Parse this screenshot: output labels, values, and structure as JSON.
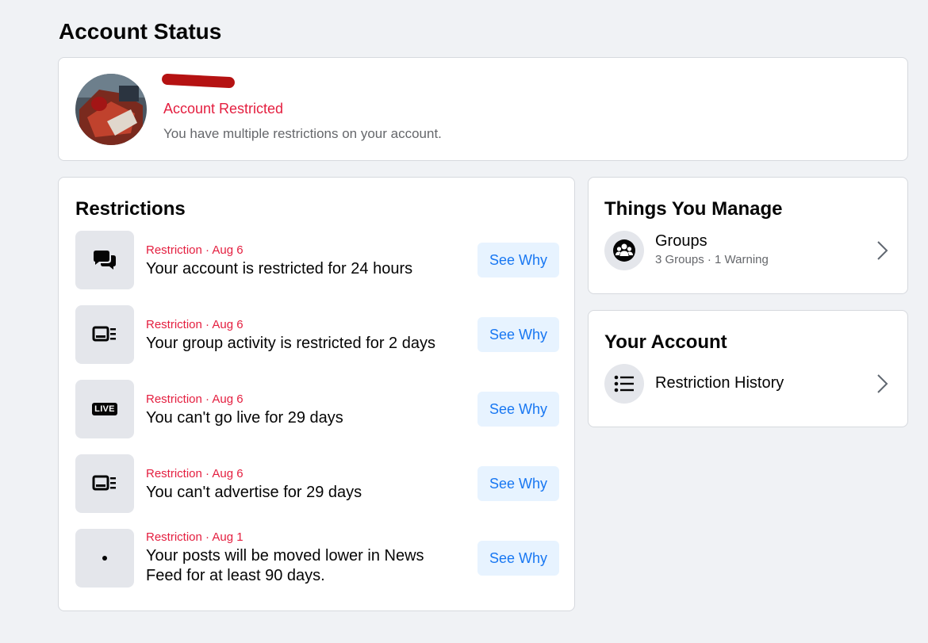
{
  "page": {
    "title": "Account Status"
  },
  "profile": {
    "status": "Account Restricted",
    "subtitle": "You have multiple restrictions on your account."
  },
  "restrictions": {
    "title": "Restrictions",
    "items": [
      {
        "meta": "Restriction · Aug 6",
        "title": "Your account is restricted for 24 hours",
        "icon": "chat-bubbles-icon",
        "button": "See Why"
      },
      {
        "meta": "Restriction · Aug 6",
        "title": "Your group activity is restricted for 2 days",
        "icon": "ad-layout-icon",
        "button": "See Why"
      },
      {
        "meta": "Restriction · Aug 6",
        "title": "You can't go live for 29 days",
        "icon": "live-icon",
        "icon_text": "LIVE",
        "button": "See Why"
      },
      {
        "meta": "Restriction · Aug 6",
        "title": "You can't advertise for 29 days",
        "icon": "ad-layout-icon",
        "button": "See Why"
      },
      {
        "meta": "Restriction · Aug 1",
        "title": "Your posts will be moved lower in News Feed for at least 90 days.",
        "icon": "dot-icon",
        "button": "See Why"
      }
    ]
  },
  "manage": {
    "title": "Things You Manage",
    "groups": {
      "label": "Groups",
      "sub": "3 Groups · 1 Warning",
      "icon": "groups-icon"
    }
  },
  "account": {
    "title": "Your Account",
    "history": {
      "label": "Restriction History",
      "icon": "list-icon"
    }
  },
  "colors": {
    "accent_red": "#e41e3f",
    "link_blue": "#1877f2",
    "button_bg": "#e7f3ff",
    "page_bg": "#f0f2f5"
  }
}
